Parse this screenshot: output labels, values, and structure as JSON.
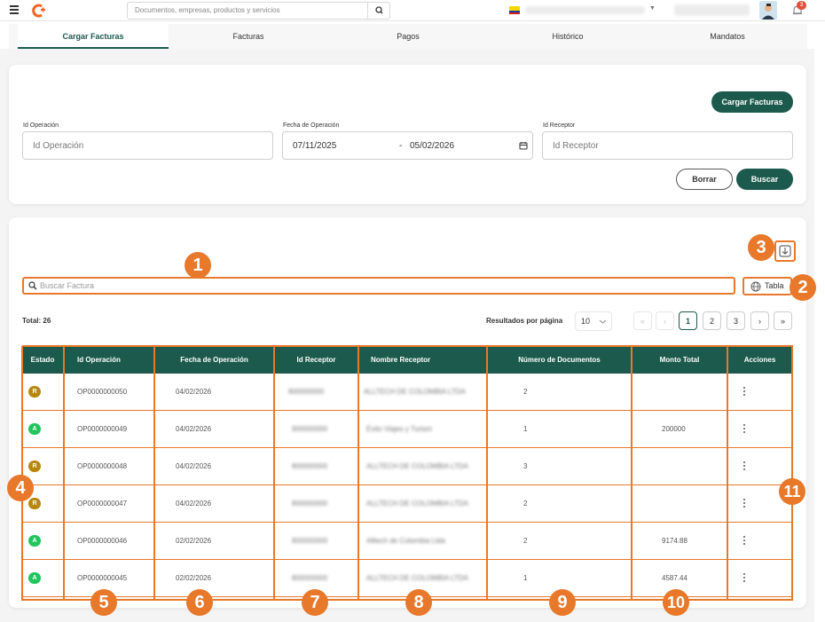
{
  "search": {
    "placeholder": "Documentos, empresas, productos y servicios"
  },
  "notifications": {
    "count": "3"
  },
  "tabs": [
    {
      "label": "Cargar Facturas"
    },
    {
      "label": "Facturas"
    },
    {
      "label": "Pagos"
    },
    {
      "label": "Histórico"
    },
    {
      "label": "Mandatos"
    }
  ],
  "filters": {
    "load_button": "Cargar Facturas",
    "id_operacion": {
      "label": "Id Operación",
      "placeholder": "Id Operación"
    },
    "fecha": {
      "label": "Fecha de Operación",
      "from": "07/11/2025",
      "separator": "-",
      "to": "05/02/2026"
    },
    "id_receptor": {
      "label": "Id Receptor",
      "placeholder": "Id Receptor"
    },
    "clear_button": "Borrar",
    "search_button": "Buscar"
  },
  "table_tools": {
    "search_placeholder": "Buscar Factura",
    "view_button": "Tabla",
    "total": "Total: 26",
    "rows_per_page_label": "Resultados por página",
    "rows_per_page": "10",
    "pages": [
      "1",
      "2",
      "3"
    ],
    "first": "«",
    "prev": "‹",
    "next": "›",
    "last": "»"
  },
  "table": {
    "headers": [
      "Estado",
      "Id Operación",
      "Fecha de Operación",
      "Id Receptor",
      "Nombre Receptor",
      "Número de Documentos",
      "Monto Total",
      "Acciones"
    ],
    "rows": [
      {
        "estado": "R",
        "estado_color": "#b8860b",
        "id": "OP0000000050",
        "fecha": "04/02/2026",
        "receptor": "800000000",
        "nombre": "ALLTECH DE COLOMBIA LTDA",
        "docs": "2",
        "monto": ""
      },
      {
        "estado": "A",
        "estado_color": "#22c55e",
        "id": "OP0000000049",
        "fecha": "04/02/2026",
        "receptor": "900000000",
        "nombre": "Éxito Viajes y Turism",
        "docs": "1",
        "monto": "200000"
      },
      {
        "estado": "R",
        "estado_color": "#b8860b",
        "id": "OP0000000048",
        "fecha": "04/02/2026",
        "receptor": "800000000",
        "nombre": "ALLTECH DE COLOMBIA LTDA",
        "docs": "3",
        "monto": ""
      },
      {
        "estado": "R",
        "estado_color": "#b8860b",
        "id": "OP0000000047",
        "fecha": "04/02/2026",
        "receptor": "800000000",
        "nombre": "ALLTECH DE COLOMBIA LTDA",
        "docs": "2",
        "monto": ""
      },
      {
        "estado": "A",
        "estado_color": "#22c55e",
        "id": "OP0000000046",
        "fecha": "02/02/2026",
        "receptor": "800000000",
        "nombre": "Alltech de Colombia Ltda",
        "docs": "2",
        "monto": "9174.88"
      },
      {
        "estado": "A",
        "estado_color": "#22c55e",
        "id": "OP0000000045",
        "fecha": "02/02/2026",
        "receptor": "800000000",
        "nombre": "ALLTECH DE COLOMBIA LTDA",
        "docs": "1",
        "monto": "4587.44"
      }
    ]
  },
  "annotations": [
    "1",
    "2",
    "3",
    "4",
    "5",
    "6",
    "7",
    "8",
    "9",
    "10",
    "11"
  ],
  "colors": {
    "primary": "#1c5a4d",
    "annotation": "#e8782a"
  }
}
